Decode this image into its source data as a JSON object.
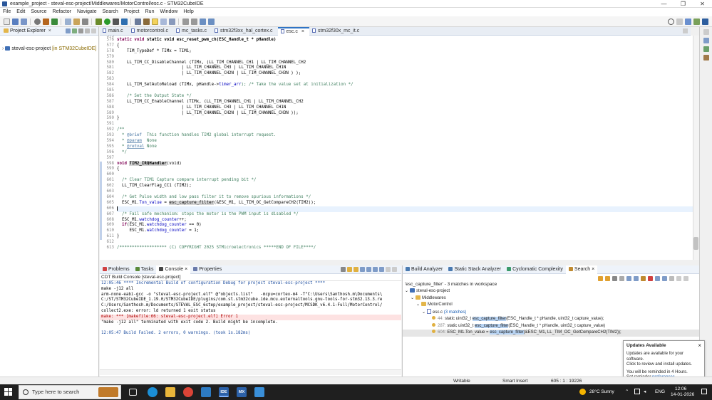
{
  "window": {
    "title": "example_project - steval-esc-project/Middlewares/MotorControl/esc.c - STM32CubeIDE",
    "controls": [
      "—",
      "❐",
      "✕"
    ]
  },
  "menu": [
    "File",
    "Edit",
    "Source",
    "Refactor",
    "Navigate",
    "Search",
    "Project",
    "Run",
    "Window",
    "Help"
  ],
  "explorer": {
    "tab_label": "Project Explorer",
    "project_name": "steval-esc-project",
    "project_suffix": "[in STM32CubeIDE]"
  },
  "editor": {
    "tabs": [
      {
        "label": "main.c",
        "active": false
      },
      {
        "label": "motorcontrol.c",
        "active": false
      },
      {
        "label": "mc_tasks.c",
        "active": false
      },
      {
        "label": "stm32f3xx_hal_cortex.c",
        "active": false
      },
      {
        "label": "esc.c",
        "active": true
      },
      {
        "label": "stm32f30x_mc_it.c",
        "active": false
      }
    ],
    "line_numbers": [
      "576",
      "577",
      "578",
      "579",
      "580",
      "581",
      "582",
      "583",
      "584",
      "585",
      "586",
      "587",
      "588",
      "589",
      "590",
      "591",
      "592",
      "593",
      "594",
      "595",
      "596",
      "597",
      "598",
      "599",
      "600",
      "601",
      "602",
      "603",
      "604",
      "605",
      "606",
      "607",
      "608",
      "609",
      "610",
      "611",
      "612",
      "613"
    ],
    "top_partial": "575",
    "code": {
      "l575": "static void esc_reset_pwm_ch(ESC_Handle_t * pHandle)",
      "l576": "{",
      "l578": "    TIM_TypeDef * TIMx = TIM1;",
      "l580": "    LL_TIM_CC_DisableChannel (TIMx, (LL_TIM_CHANNEL_CH1 | LL_TIM_CHANNEL_CH2",
      "l581": "                          | LL_TIM_CHANNEL_CH3 | LL_TIM_CHANNEL_CH1N",
      "l582": "                          | LL_TIM_CHANNEL_CH2N | LL_TIM_CHANNEL_CH3N ) );",
      "l584a": "    LL_TIM_SetAutoReload (TIMx, pHandle->",
      "l584b": "timer_arr",
      "l584c": "); /* Take the value set at initialization */",
      "l586": "    /* Set the Output State */",
      "l587": "    LL_TIM_CC_EnableChannel (TIMx, (LL_TIM_CHANNEL_CH1 | LL_TIM_CHANNEL_CH2",
      "l588": "                          | LL_TIM_CHANNEL_CH3 | LL_TIM_CHANNEL_CH1N",
      "l589": "                          | LL_TIM_CHANNEL_CH2N | LL_TIM_CHANNEL_CH3N ));",
      "l590": "}",
      "l592": "/**",
      "l593a": "  * ",
      "l593b": "@brief",
      "l593c": "  This function handles TIM2 global interrupt request.",
      "l594a": "  * ",
      "l594b": "@param",
      "l594c": "  None",
      "l595a": "  * ",
      "l595b": "@retval",
      "l595c": " None",
      "l596": "  */",
      "l598a": "void ",
      "l598b": "TIM2_IRQHandler",
      "l598c": "(void)",
      "l599": "{",
      "l601": "  /* Clear TIM1 Capture compare interrupt pending bit */",
      "l602": "  LL_TIM_ClearFlag_CC1 (TIM2);",
      "l604": "  /* Get Pulse width and low pass filter it to remove spurious informations */",
      "l605a": "  ESC_M1.",
      "l605b": "Ton_value",
      "l605c": " = ",
      "l605d": "esc_capture_filter",
      "l605e": "(&ESC_M1, LL_TIM_OC_GetCompareCH2(TIM2));",
      "l607": "  /* Fail safe mechanism: stops the motor is the PWM input is disabled */",
      "l608a": "  ESC_M1.",
      "l608b": "watchdog_counter",
      "l608c": "++;",
      "l609a": "  if",
      "l609b": "(ESC_M1.",
      "l609c": "watchdog_counter",
      "l609d": " == 0)",
      "l610a": "     ESC_M1.",
      "l610b": "watchdog_counter",
      "l610c": " = 1;",
      "l611": "}",
      "l613": "/******************* (C) COPYRIGHT 2025 STMicroelectronics *****END OF FILE****/"
    }
  },
  "bottom_left": {
    "tabs": [
      "Problems",
      "Tasks",
      "Console",
      "Properties"
    ],
    "active_tab": "Console",
    "header": "CDT Build Console [steval-esc-project]",
    "lines": [
      {
        "text": "12:05:46 **** Incremental Build of configuration Debug for project steval-esc-project ****",
        "style": "blue"
      },
      {
        "text": "make -j12 all",
        "style": ""
      },
      {
        "text": "arm-none-eabi-gcc -o \"steval-esc-project.elf\" @\"objects.list\"   -mcpu=cortex-m4 -T\"C:\\Users\\Santhosh.m\\Documents\\",
        "style": ""
      },
      {
        "text": "C:/ST/STM32CubeIDE_1.19.0/STM32CubeIDE/plugins/com.st.stm32cube.ide.mcu.externaltools.gnu-tools-for-stm32.13.3.re",
        "style": ""
      },
      {
        "text": "C:/Users/Santhosh.m/Documents/STEVAL_ESC_6step/example_project/steval-esc-project/MCSDK_v6.4.1-Full/MotorControl/",
        "style": ""
      },
      {
        "text": "collect2.exe: error: ld returned 1 exit status",
        "style": ""
      },
      {
        "text": "make: *** [makefile:66: steval-esc-project.elf] Error 1",
        "style": "err"
      },
      {
        "text": "\"make -j12 all\" terminated with exit code 2. Build might be incomplete.",
        "style": ""
      },
      {
        "text": "",
        "style": ""
      },
      {
        "text": "12:05:47 Build Failed. 2 errors, 0 warnings. (took 1s.182ms)",
        "style": "blue"
      }
    ]
  },
  "bottom_right": {
    "tabs": [
      "Build Analyzer",
      "Static Stack Analyzer",
      "Cyclomatic Complexity",
      "Search"
    ],
    "active_tab": "Search",
    "summary": "'esc_capture_filter' - 3 matches in workspace",
    "tree": {
      "project": "steval-esc-project",
      "folder1": "Middlewares",
      "folder2": "MotorControl",
      "file": "esc.c",
      "file_count": "(3 matches)"
    },
    "results": [
      {
        "lnum": "44:",
        "pre": " static uint32_t ",
        "match": "esc_capture_filter",
        "post": "(ESC_Handle_t * pHandle, uint32_t capture_value);",
        "selected": false
      },
      {
        "lnum": "287:",
        "pre": " static uint32_t ",
        "match": "esc_capture_filter",
        "post": "(ESC_Handle_t * pHandle, uint32_t capture_value)",
        "selected": false
      },
      {
        "lnum": "604:",
        "pre": " ESC_M1.Ton_value = ",
        "match": "esc_capture_filter",
        "post": "(&ESC_M1, LL_TIM_OC_GetCompareCH2(TIM2));",
        "selected": true
      }
    ]
  },
  "notification": {
    "title": "Updates Available",
    "body1": "Updates are available for your software.",
    "body2": "Click to review and install updates.",
    "body3": "You will be reminded in 4 Hours.",
    "body4": "Set reminder ",
    "link": "preferences"
  },
  "statusbar": {
    "mode": "Writable",
    "insert": "Smart Insert",
    "position": "605 : 1 : 19226"
  },
  "taskbar": {
    "search_placeholder": "Type here to search",
    "weather": "28°C  Sunny",
    "lang": "ENG",
    "time": "12:06",
    "date": "14-01-2026",
    "app_ide": "IDE",
    "app_mx": "MX"
  },
  "colors": {
    "keyword": "#7f0055",
    "comment": "#3f7f5f",
    "field": "#0000c0",
    "accent": "#2f74c5"
  }
}
